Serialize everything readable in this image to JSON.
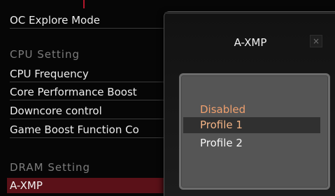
{
  "list": {
    "items": [
      {
        "label": "OC Explore Mode"
      },
      {
        "label": "CPU Frequency"
      },
      {
        "label": "Core Performance Boost"
      },
      {
        "label": "Downcore control"
      },
      {
        "label": "Game Boost Function Co"
      }
    ],
    "cpu_section_title": "CPU  Setting",
    "dram_section_title": "DRAM  Setting",
    "selected_item": "A-XMP"
  },
  "popup": {
    "title": "A-XMP",
    "close_label": "×",
    "options": [
      {
        "label": "Disabled"
      },
      {
        "label": "Profile 1"
      },
      {
        "label": "Profile 2"
      }
    ],
    "selected_index": 1
  },
  "colors": {
    "selected_row": "#5a1118",
    "disabled_option": "#f0a06e",
    "highlight_option": "#f3b486",
    "normal_option": "#f6f6f6",
    "section_title": "#7c7c7c"
  }
}
